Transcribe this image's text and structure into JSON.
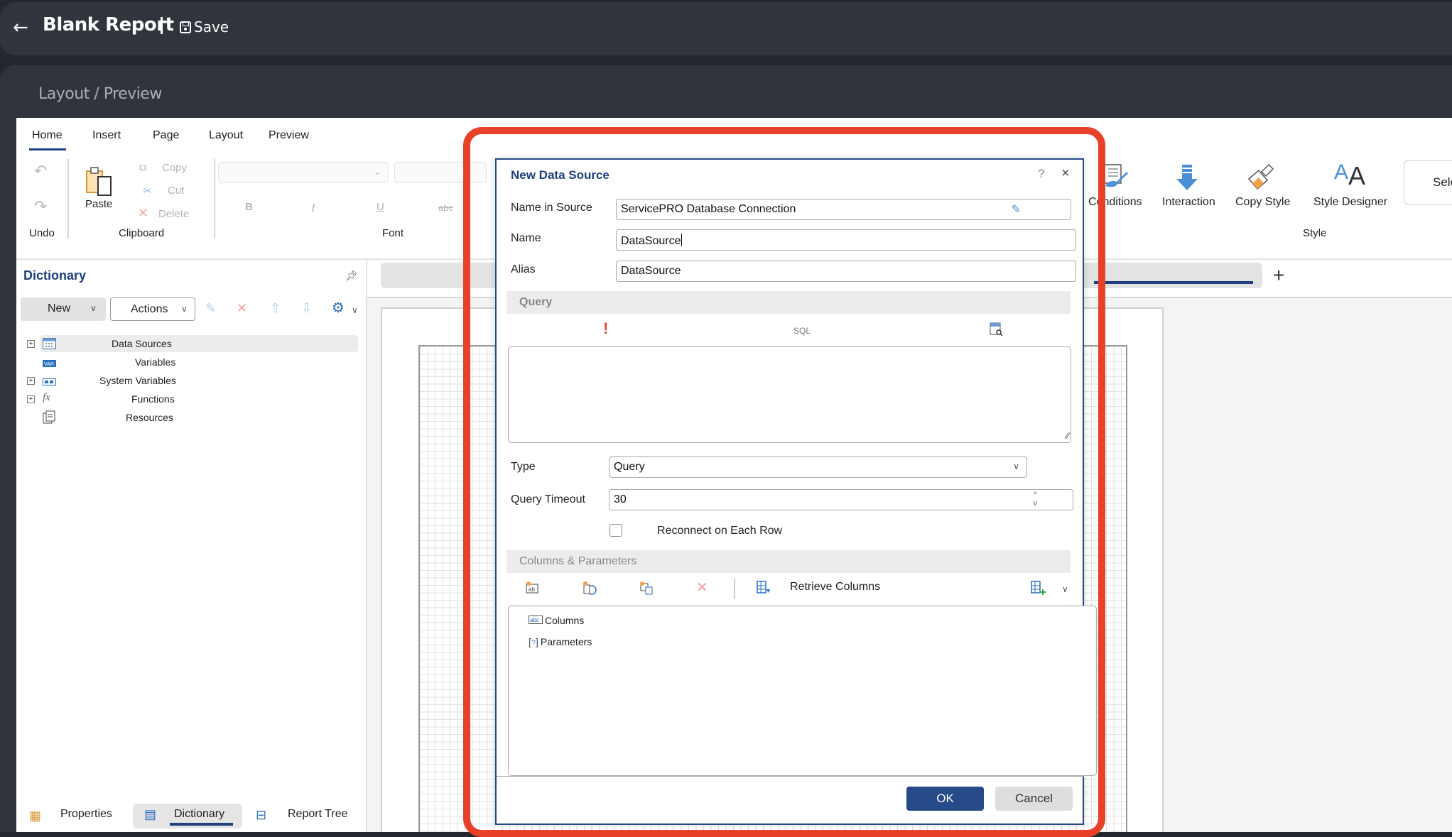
{
  "header": {
    "title": "Blank Report",
    "save_label": "Save"
  },
  "section_title": {
    "part1": "Layout",
    "slash": " / ",
    "part2": "Preview"
  },
  "ribbon": {
    "tabs": [
      "Home",
      "Insert",
      "Page",
      "Layout",
      "Preview"
    ],
    "active_tab": "Home",
    "undo_label": "Undo",
    "paste_label": "Paste",
    "copy_label": "Copy",
    "cut_label": "Cut",
    "delete_label": "Delete",
    "clipboard_group": "Clipboard",
    "font_group": "Font",
    "bold": "B",
    "italic": "I",
    "underline": "U",
    "strike": "abc",
    "conditions_label": "Conditions",
    "interaction_label": "Interaction",
    "copy_style_label": "Copy Style",
    "style_designer_label": "Style Designer",
    "style_group": "Style",
    "select_label": "Sele"
  },
  "dictionary": {
    "title": "Dictionary",
    "new_label": "New",
    "actions_label": "Actions",
    "tree": [
      {
        "label": "Data Sources",
        "expandable": true,
        "selected": true
      },
      {
        "label": "Variables",
        "expandable": false
      },
      {
        "label": "System Variables",
        "expandable": true
      },
      {
        "label": "Functions",
        "expandable": true
      },
      {
        "label": "Resources",
        "expandable": false
      }
    ]
  },
  "bottom_tabs": {
    "properties": "Properties",
    "dictionary": "Dictionary",
    "report_tree": "Report Tree",
    "active": "Dictionary"
  },
  "canvas": {
    "add_page": "+"
  },
  "dialog": {
    "title": "New Data Source",
    "help": "?",
    "close": "×",
    "fields": {
      "name_in_source_label": "Name in Source",
      "name_in_source_value": "ServicePRO Database Connection",
      "name_label": "Name",
      "name_value": "DataSource",
      "alias_label": "Alias",
      "alias_value": "DataSource"
    },
    "query_section": "Query",
    "query_toolbar": {
      "run_icon": "!",
      "sql_label": "SQL",
      "preview_icon": "query-preview"
    },
    "query_text": "",
    "type_label": "Type",
    "type_value": "Query",
    "timeout_label": "Query Timeout",
    "timeout_value": "30",
    "reconnect_label": "Reconnect on Each Row",
    "reconnect_checked": false,
    "columns_section": "Columns & Parameters",
    "retrieve_columns": "Retrieve Columns",
    "tree": {
      "columns": "Columns",
      "parameters": "Parameters"
    },
    "ok_label": "OK",
    "cancel_label": "Cancel"
  },
  "colors": {
    "accent": "#1f3f7f",
    "ok_button": "#264a8a",
    "annotation": "#e8412a",
    "topbar": "#30353d"
  }
}
